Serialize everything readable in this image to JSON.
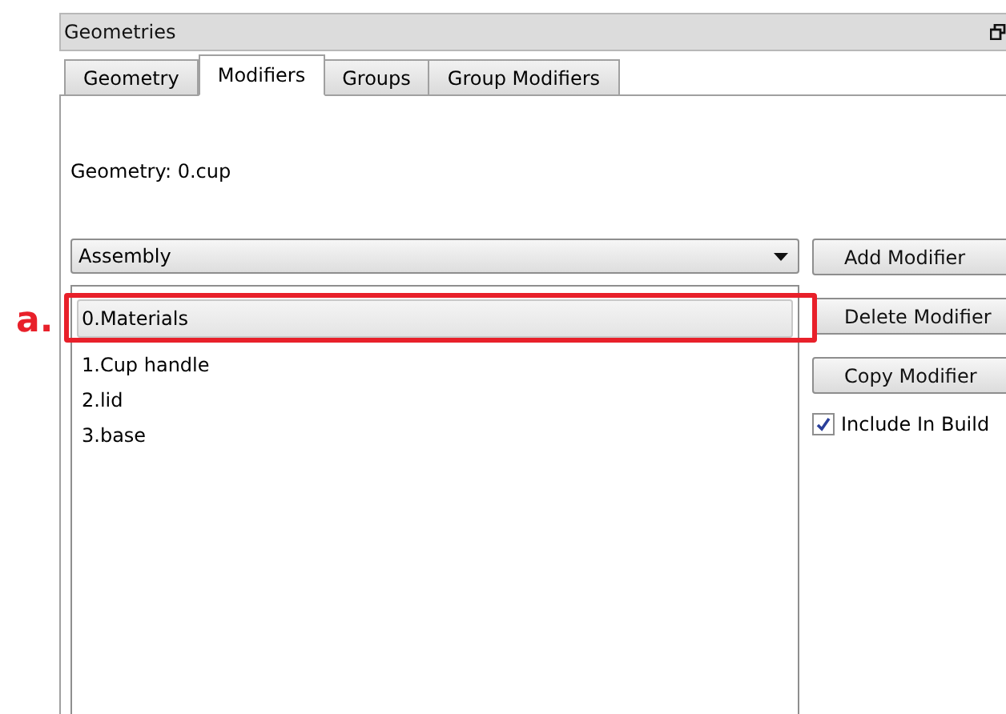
{
  "panel": {
    "title": "Geometries"
  },
  "tabs": [
    {
      "label": "Geometry",
      "selected": false
    },
    {
      "label": "Modifiers",
      "selected": true
    },
    {
      "label": "Groups",
      "selected": false
    },
    {
      "label": "Group Modifiers",
      "selected": false
    }
  ],
  "geometry_label": "Geometry: 0.cup",
  "dropdown": {
    "value": "Assembly"
  },
  "modifiers": [
    {
      "label": "0.Materials",
      "selected": true
    },
    {
      "label": "1.Cup handle",
      "selected": false
    },
    {
      "label": "2.lid",
      "selected": false
    },
    {
      "label": "3.base",
      "selected": false
    }
  ],
  "buttons": [
    "Add Modifier",
    "Delete Modifier",
    "Copy Modifier"
  ],
  "include_in_build": {
    "label": "Include In Build",
    "checked": true
  },
  "annotation": {
    "label": "a."
  }
}
